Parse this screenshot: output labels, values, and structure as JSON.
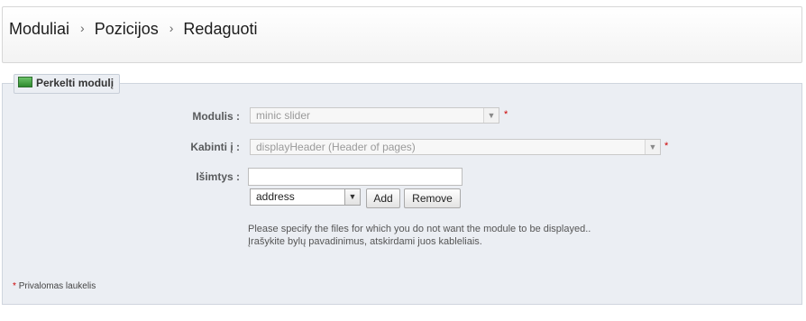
{
  "breadcrumb": {
    "items": [
      "Moduliai",
      "Pozicijos",
      "Redaguoti"
    ],
    "separator": "›"
  },
  "panel": {
    "legend": "Perkelti modulį",
    "legend_icon": "green-module-icon"
  },
  "form": {
    "module": {
      "label": "Modulis :",
      "value": "minic slider",
      "required_mark": "*"
    },
    "hook": {
      "label": "Kabinti į :",
      "value": "displayHeader (Header of pages)",
      "required_mark": "*"
    },
    "exceptions": {
      "label": "Išimtys :",
      "input_value": "",
      "file_select_value": "address",
      "add_label": "Add",
      "remove_label": "Remove"
    },
    "help_line1": "Please specify the files for which you do not want the module to be displayed..",
    "help_line2": "Įrašykite bylų pavadinimus, atskirdami juos kableliais."
  },
  "footer": {
    "required_star": "*",
    "required_text": "Privalomas laukelis"
  },
  "colors": {
    "panel_bg": "#ebeef3",
    "required": "#cc0000"
  }
}
